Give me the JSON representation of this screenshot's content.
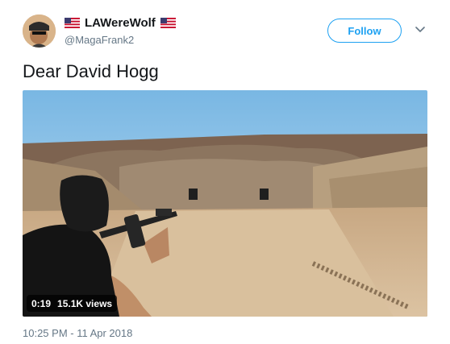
{
  "tweet": {
    "display_name": "LAWereWolf",
    "handle": "@MagaFrank2",
    "follow_label": "Follow",
    "text": "Dear David Hogg",
    "timestamp": "10:25 PM - 11 Apr 2018"
  },
  "video": {
    "duration": "0:19",
    "views": "15.1K views"
  },
  "icons": {
    "name_decorations": [
      "us-flag-icon",
      "us-flag-icon"
    ],
    "menu": "chevron-down-icon"
  },
  "colors": {
    "accent": "#1da1f2",
    "secondary_text": "#657786",
    "primary_text": "#14171a"
  }
}
